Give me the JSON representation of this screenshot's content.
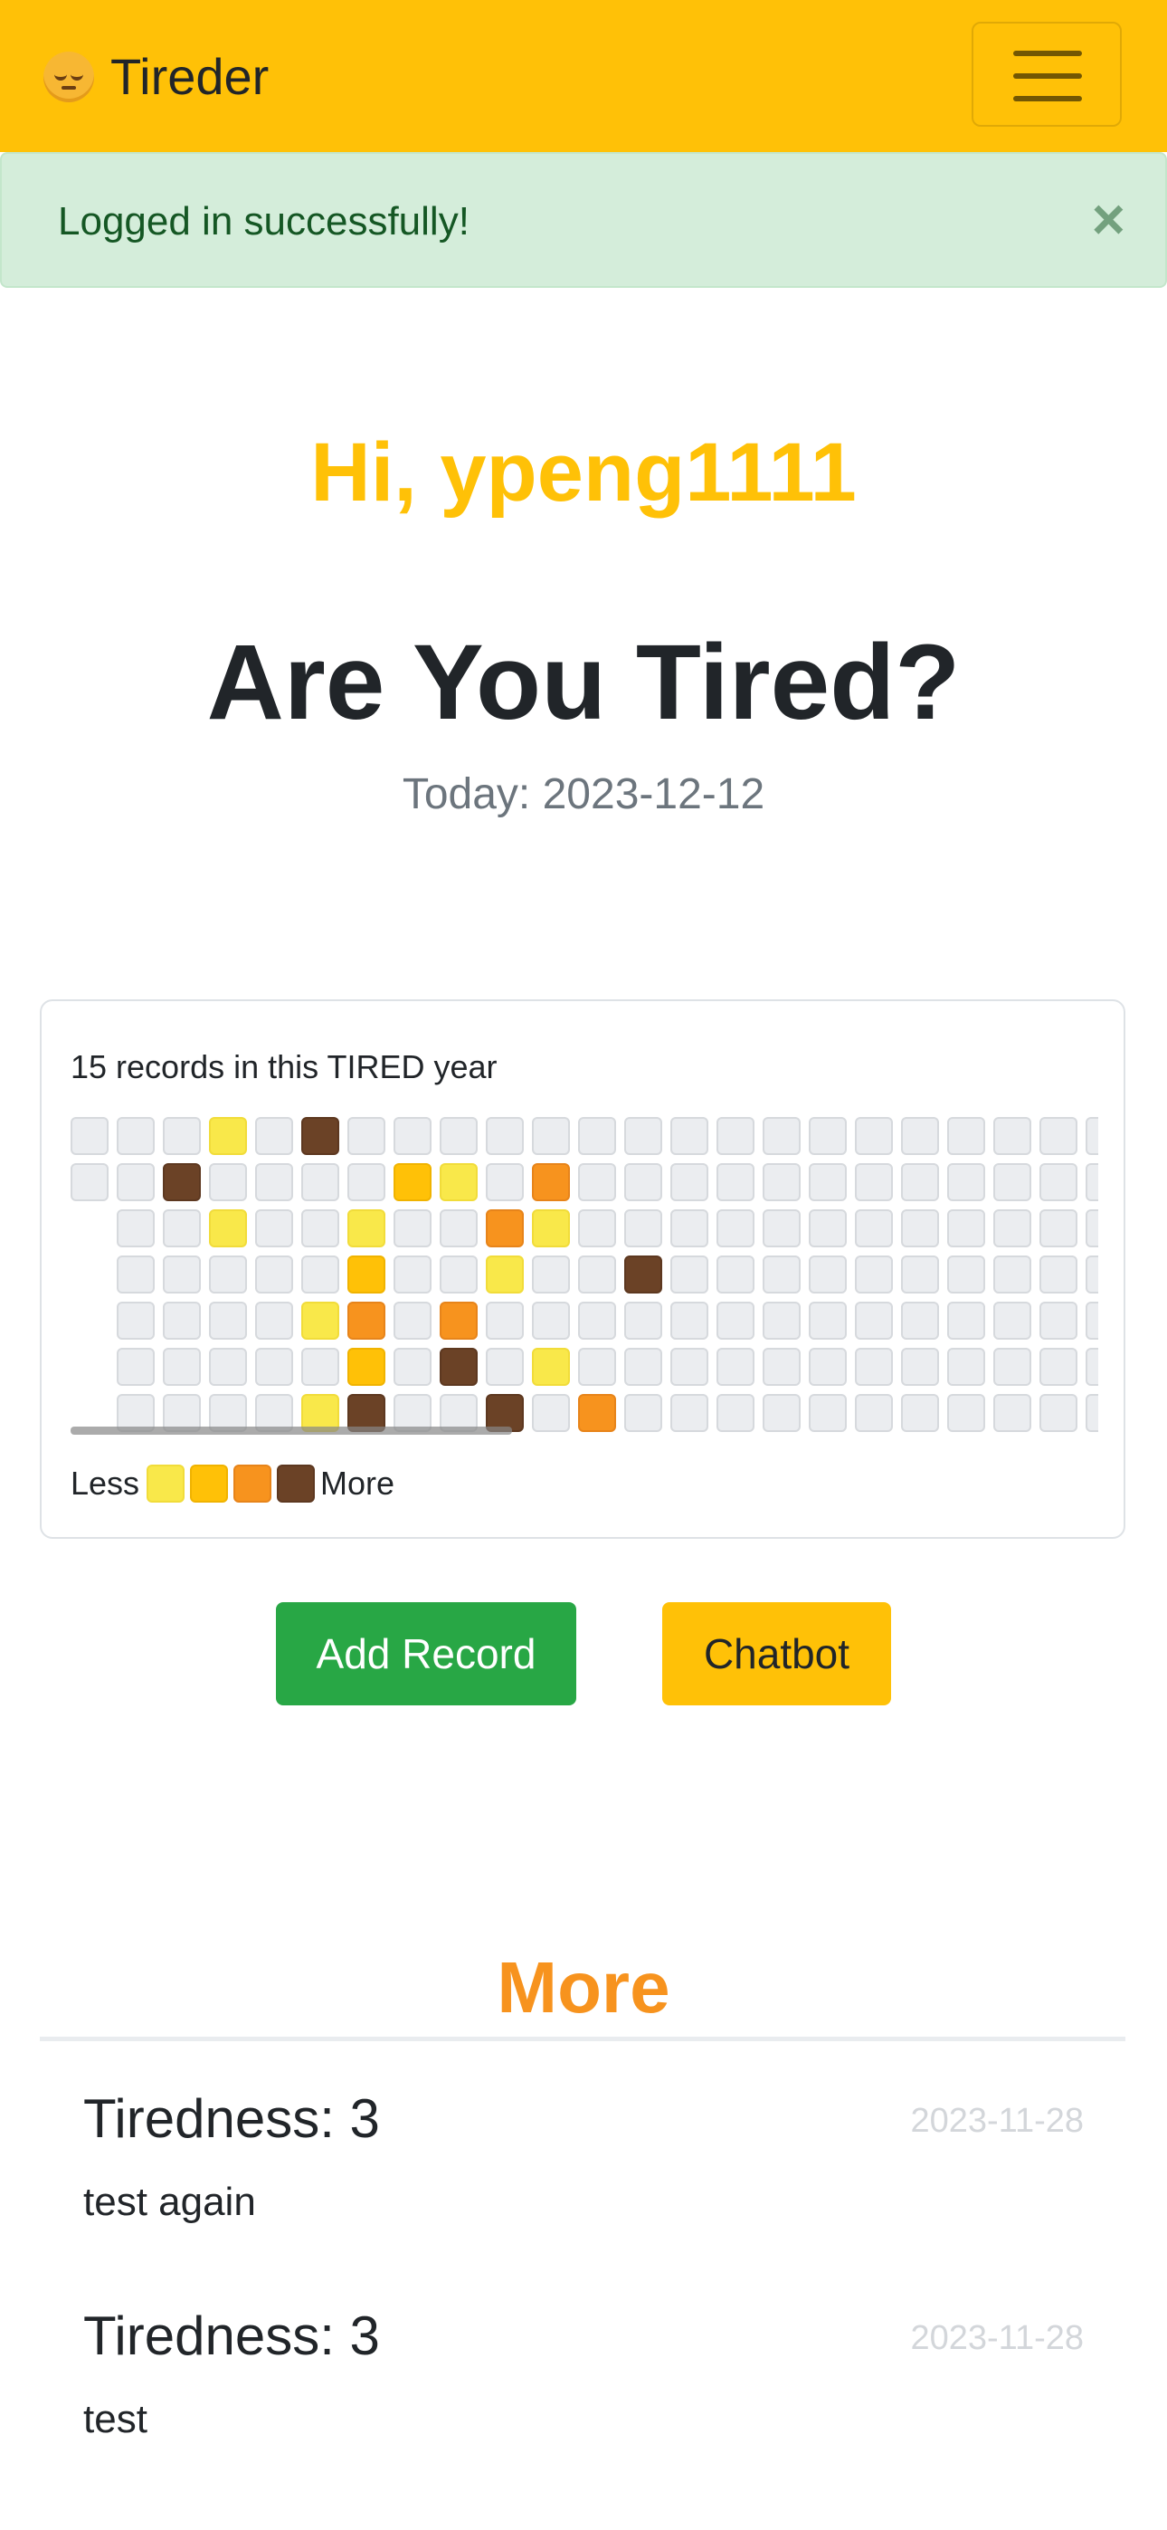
{
  "navbar": {
    "brand": "Tireder",
    "brand_icon": "tired-face-emoji-icon",
    "menu_icon": "hamburger-menu-icon",
    "color": "#ffc107"
  },
  "alert": {
    "message": "Logged in successfully!",
    "close_symbol": "×",
    "color": "#d4edda"
  },
  "greeting": "Hi, ypeng1111",
  "title": "Are You Tired?",
  "today": "Today: 2023-12-12",
  "heatmap": {
    "title": "15 records in this TIRED year",
    "legend_less": "Less",
    "legend_more": "More",
    "level_colors": [
      "#ebedf0",
      "#f9e84a",
      "#ffc107",
      "#f7931e",
      "#6b4226"
    ],
    "levels_by_row": [
      [
        0,
        0,
        0,
        1,
        0,
        4,
        0,
        0,
        0,
        0,
        0,
        0,
        0,
        0,
        0,
        0,
        0,
        0,
        0,
        0,
        0,
        0,
        0
      ],
      [
        0,
        0,
        4,
        0,
        0,
        0,
        0,
        2,
        1,
        0,
        3,
        0,
        0,
        0,
        0,
        0,
        0,
        0,
        0,
        0,
        0,
        0,
        0
      ],
      [
        null,
        0,
        0,
        1,
        0,
        0,
        1,
        0,
        0,
        3,
        1,
        0,
        0,
        0,
        0,
        0,
        0,
        0,
        0,
        0,
        0,
        0,
        0
      ],
      [
        null,
        0,
        0,
        0,
        0,
        0,
        2,
        0,
        0,
        1,
        0,
        0,
        4,
        0,
        0,
        0,
        0,
        0,
        0,
        0,
        0,
        0,
        0
      ],
      [
        null,
        0,
        0,
        0,
        0,
        1,
        3,
        0,
        3,
        0,
        0,
        0,
        0,
        0,
        0,
        0,
        0,
        0,
        0,
        0,
        0,
        0,
        0
      ],
      [
        null,
        0,
        0,
        0,
        0,
        0,
        2,
        0,
        4,
        0,
        1,
        0,
        0,
        0,
        0,
        0,
        0,
        0,
        0,
        0,
        0,
        0,
        0
      ],
      [
        null,
        0,
        0,
        0,
        0,
        1,
        4,
        0,
        0,
        4,
        0,
        3,
        0,
        0,
        0,
        0,
        0,
        0,
        0,
        0,
        0,
        0,
        0
      ]
    ]
  },
  "buttons": {
    "add_record": "Add Record",
    "chatbot": "Chatbot"
  },
  "more": {
    "title": "More",
    "records": [
      {
        "title": "Tiredness: 3",
        "date": "2023-11-28",
        "note": "test again"
      },
      {
        "title": "Tiredness: 3",
        "date": "2023-11-28",
        "note": "test"
      }
    ]
  }
}
